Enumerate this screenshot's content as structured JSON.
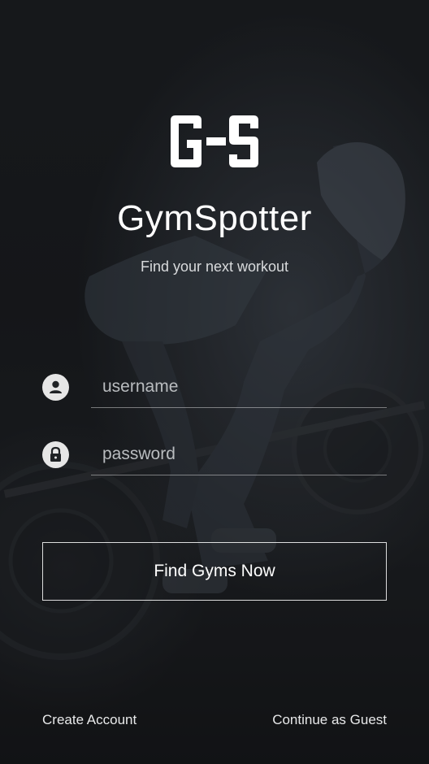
{
  "brand": {
    "logo_text": "G-S",
    "app_name": "GymSpotter",
    "tagline": "Find your next workout"
  },
  "login_form": {
    "username": {
      "placeholder": "username",
      "value": "",
      "icon": "user-icon"
    },
    "password": {
      "placeholder": "password",
      "value": "",
      "icon": "lock-icon"
    },
    "submit_label": "Find Gyms Now"
  },
  "footer": {
    "create_account_label": "Create Account",
    "guest_label": "Continue as Guest"
  },
  "colors": {
    "background": "#171a1d",
    "text": "#ffffff",
    "muted_text": "#b9bcbf",
    "icon_circle": "#e6e6e6"
  }
}
